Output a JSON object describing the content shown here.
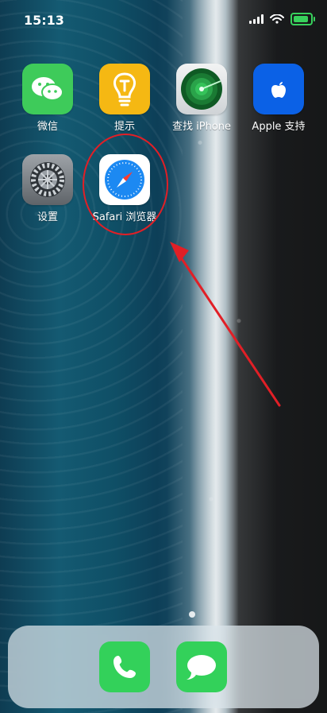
{
  "status": {
    "time": "15:13"
  },
  "apps": [
    {
      "label": "微信",
      "icon": "wechat-icon"
    },
    {
      "label": "提示",
      "icon": "tips-icon"
    },
    {
      "label": "查找 iPhone",
      "icon": "find-iphone-icon"
    },
    {
      "label": "Apple 支持",
      "icon": "apple-support-icon"
    },
    {
      "label": "设置",
      "icon": "settings-icon"
    },
    {
      "label": "Safari 浏览器",
      "icon": "safari-icon"
    }
  ],
  "dock": [
    {
      "icon": "phone-icon"
    },
    {
      "icon": "messages-icon"
    }
  ],
  "colors": {
    "annotation_red": "#e11f26",
    "wechat_green": "#3ecb5a",
    "tips_yellow": "#f5b813",
    "apple_blue": "#0b61e6",
    "dock_green": "#33d15a"
  }
}
